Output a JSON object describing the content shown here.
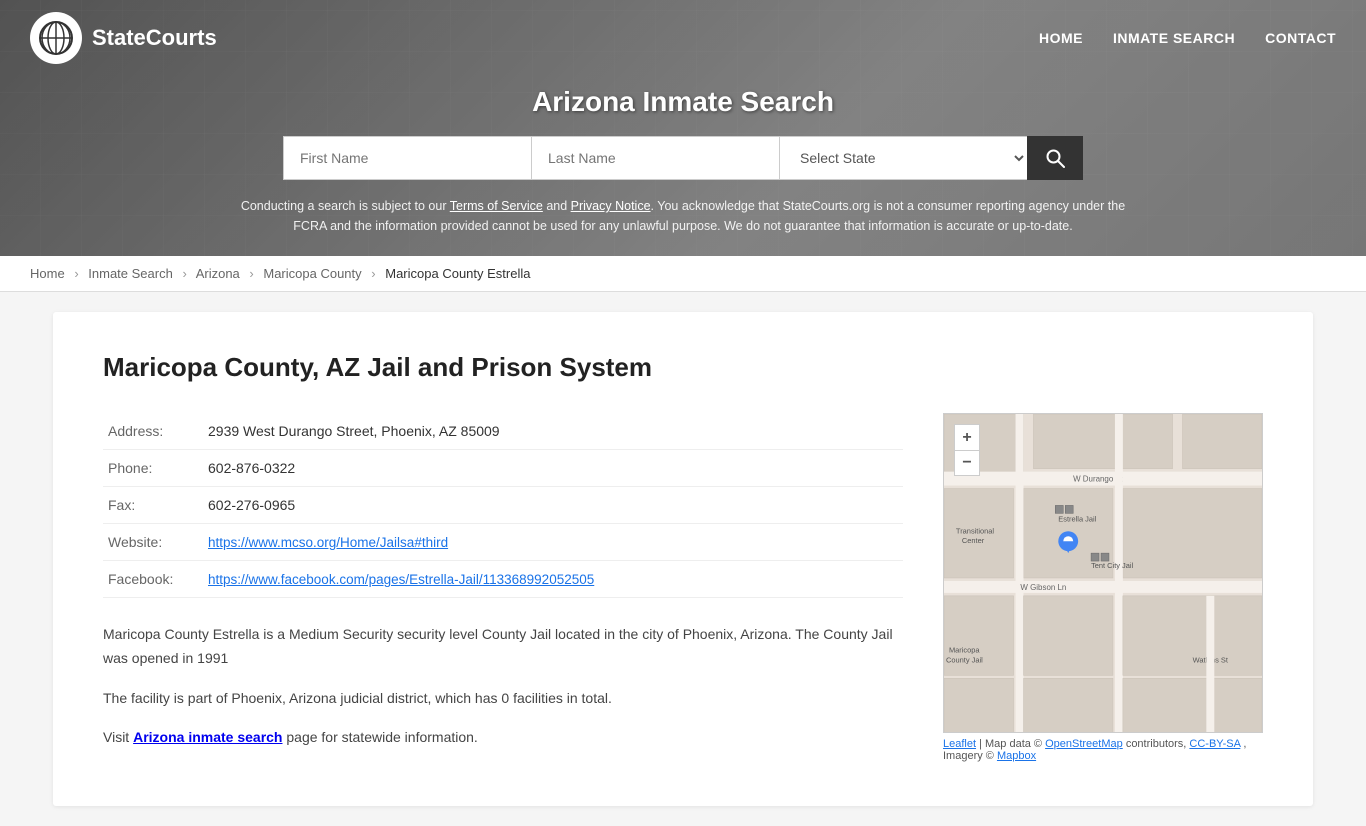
{
  "site": {
    "logo_text": "StateCourts",
    "logo_icon": "⊕"
  },
  "nav": {
    "home_label": "HOME",
    "inmate_search_label": "INMATE SEARCH",
    "contact_label": "CONTACT"
  },
  "hero": {
    "title": "Arizona Inmate Search",
    "search": {
      "first_name_placeholder": "First Name",
      "last_name_placeholder": "Last Name",
      "select_state_label": "Select State",
      "search_button_label": "🔍"
    },
    "disclaimer": "Conducting a search is subject to our Terms of Service and Privacy Notice. You acknowledge that StateCourts.org is not a consumer reporting agency under the FCRA and the information provided cannot be used for any unlawful purpose. We do not guarantee that information is accurate or up-to-date."
  },
  "breadcrumb": {
    "home": "Home",
    "inmate_search": "Inmate Search",
    "state": "Arizona",
    "county": "Maricopa County",
    "current": "Maricopa County Estrella"
  },
  "facility": {
    "title": "Maricopa County, AZ Jail and Prison System",
    "address_label": "Address:",
    "address_value": "2939 West Durango Street, Phoenix, AZ 85009",
    "phone_label": "Phone:",
    "phone_value": "602-876-0322",
    "fax_label": "Fax:",
    "fax_value": "602-276-0965",
    "website_label": "Website:",
    "website_url": "https://www.mcso.org/Home/Jailsa#third",
    "facebook_label": "Facebook:",
    "facebook_url": "https://www.facebook.com/pages/Estrella-Jail/113368992052505",
    "desc1": "Maricopa County Estrella is a Medium Security security level County Jail located in the city of Phoenix, Arizona. The County Jail was opened in 1991",
    "desc2": "The facility is part of Phoenix, Arizona judicial district, which has 0 facilities in total.",
    "desc3_prefix": "Visit ",
    "desc3_link_text": "Arizona inmate search",
    "desc3_suffix": " page for statewide information."
  },
  "map": {
    "zoom_in": "+",
    "zoom_out": "−",
    "street1": "W Durango St",
    "street2": "W Gibson Ln",
    "label1": "Transitional Center",
    "label2": "Estrella Jail",
    "label3": "Tent City Jail",
    "label4": "Maricopa County Jail",
    "label5": "Watkins St",
    "credits_leaflet": "Leaflet",
    "credits_osm": "OpenStreetMap",
    "credits_ccbysa": "CC-BY-SA",
    "credits_mapbox": "Mapbox",
    "credits_text": " | Map data © ",
    "credits_text2": " contributors, ",
    "credits_text3": ", Imagery © "
  }
}
